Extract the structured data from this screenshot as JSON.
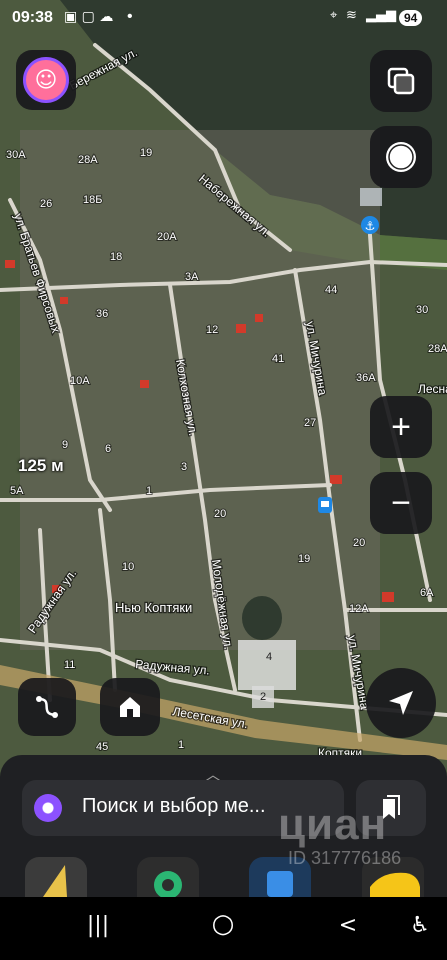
{
  "status_bar": {
    "time": "09:38",
    "dot": "•",
    "battery": "94",
    "icons": [
      "location-icon",
      "wifi-icon",
      "signal-icon",
      "signal-icon"
    ]
  },
  "map": {
    "scale_label": "125 м",
    "area_label": "Нью Коптяки",
    "bottom_label": "Коптяки",
    "streets": {
      "berezhnaya": "Бережная ул.",
      "naberezhnaya": "Набережная ул.",
      "brothers": "ул. Братьев Фирсовых",
      "kolkhoznaya": "Колхозная ул.",
      "michurina_top": "ул. Мичурина",
      "molodezhnaya": "Молодёжная ул.",
      "raduzhnaya_1": "Радужная ул.",
      "raduzhnaya_2": "Радужная ул.",
      "lesnaya": "Лесна",
      "michurina_bottom": "ул. Мичурина",
      "lesetskaya": "Лесетская ул."
    },
    "house_numbers": [
      "30А",
      "28А",
      "19",
      "26",
      "18Б",
      "20А",
      "18",
      "3А",
      "44",
      "30",
      "36",
      "12",
      "41",
      "28А",
      "10А",
      "36А",
      "9",
      "6",
      "3",
      "27",
      "5А",
      "1",
      "20",
      "20",
      "10",
      "19",
      "12А",
      "6А",
      "11",
      "4",
      "2",
      "45",
      "1"
    ],
    "colors": {
      "water": "#2f3a2f",
      "terrain": "#4a5a3c",
      "road": "#d9d6cc",
      "roof_red": "#d23a2a"
    }
  },
  "controls": {
    "layers_icon": "layers-icon",
    "compass_icon": "compass-icon",
    "zoom_in": "+",
    "zoom_out": "−",
    "route_icon": "route-icon",
    "home_icon": "home-icon",
    "locate_icon": "navigation-arrow-icon"
  },
  "bottom_sheet": {
    "search_text": "Поиск и выбор ме...",
    "bookmarks_icon": "bookmarks-icon"
  },
  "watermark": {
    "text": "циан",
    "id": "ID 317776186"
  },
  "nav_bar": {
    "recents": "|||",
    "home": "○",
    "back": "<",
    "accessibility_icon": "accessibility-icon"
  }
}
